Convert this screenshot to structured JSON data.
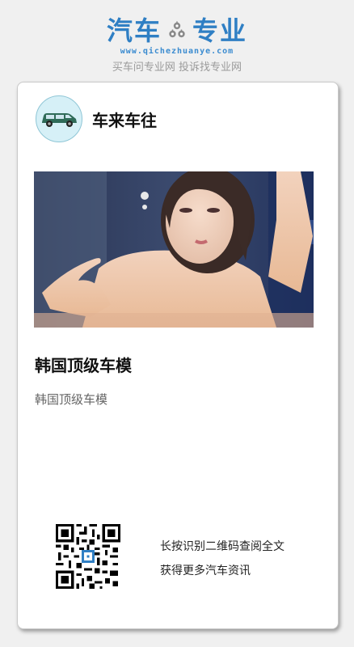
{
  "header": {
    "logo_left": "汽车",
    "logo_right": "专业",
    "logo_url": "www.qichezhuanye.com",
    "slogan": "买车问专业网 投诉找专业网",
    "brand_color": "#2f7fc4"
  },
  "author": {
    "name": "车来车往",
    "avatar_icon": "green-car-icon"
  },
  "article": {
    "image_icon": "car-model-photo",
    "title": "韩国顶级车模",
    "summary": "韩国顶级车模"
  },
  "footer": {
    "qr_icon": "qr-code-icon",
    "line1": "长按识别二维码查阅全文",
    "line2": "获得更多汽车资讯"
  }
}
